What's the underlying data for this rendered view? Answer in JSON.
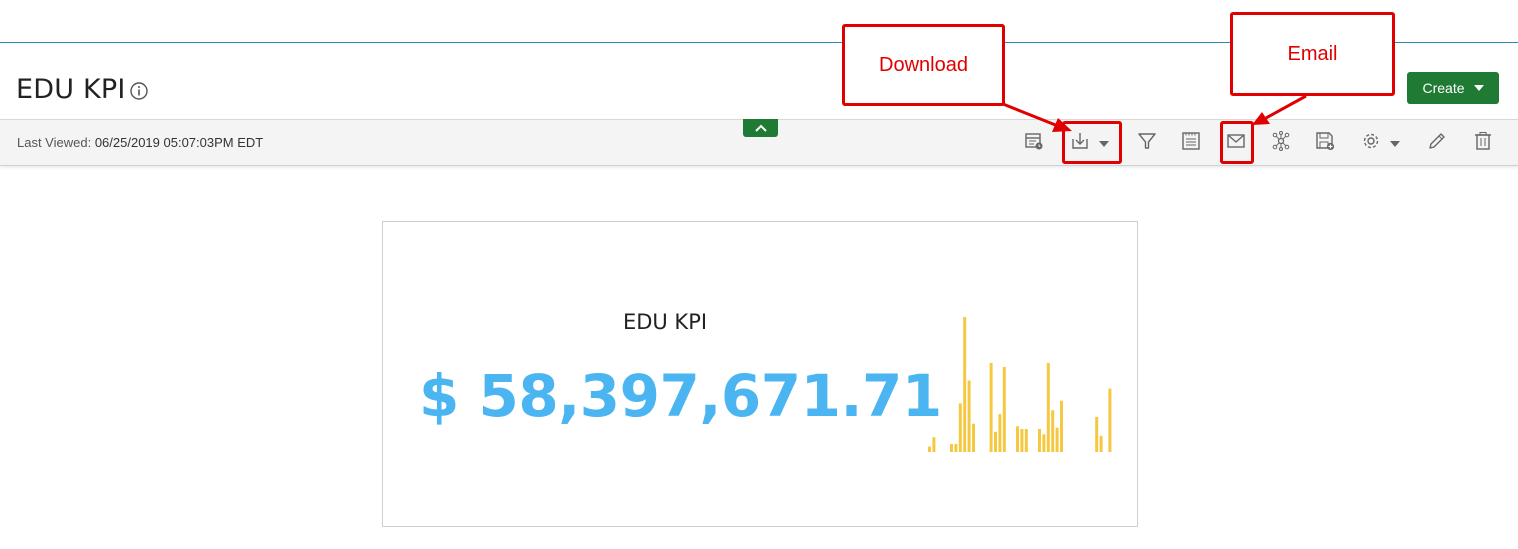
{
  "header": {
    "title": "EDU KPI",
    "create_label": "Create"
  },
  "toolbar": {
    "last_viewed_label": "Last Viewed:",
    "last_viewed_value": "06/25/2019 05:07:03PM EDT",
    "icons": [
      "report-schedule-icon",
      "download-icon",
      "filter-icon",
      "notes-icon",
      "email-icon",
      "network-icon",
      "save-as-icon",
      "settings-icon",
      "edit-icon",
      "delete-icon"
    ]
  },
  "callouts": {
    "download": "Download",
    "email": "Email"
  },
  "kpi": {
    "title": "EDU KPI",
    "value": "$ 58,397,671.71"
  },
  "colors": {
    "accent": "#1f7a34",
    "kpi_value": "#4ab5f0",
    "sparkline": "#f5c842",
    "annotation": "#e00000",
    "top_rule": "#2a8bb0"
  },
  "chart_data": {
    "type": "bar",
    "title": "",
    "xlabel": "",
    "ylabel": "",
    "values": [
      0.04,
      0.11,
      0,
      0,
      0,
      0.06,
      0.06,
      0.36,
      1.0,
      0.53,
      0.21,
      0,
      0,
      0,
      0.66,
      0.15,
      0.28,
      0.63,
      0,
      0,
      0.19,
      0.17,
      0.17,
      0,
      0,
      0.17,
      0.13,
      0.66,
      0.31,
      0.18,
      0.38,
      0,
      0,
      0,
      0,
      0,
      0,
      0,
      0.26,
      0.12,
      0,
      0.47
    ],
    "ylim": [
      0,
      1
    ],
    "grid": false,
    "legend": "none"
  }
}
